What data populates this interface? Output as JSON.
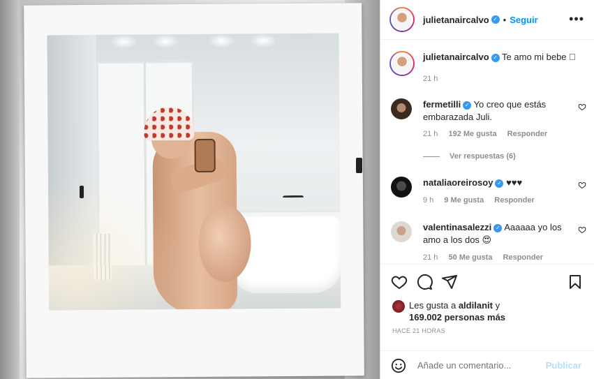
{
  "header": {
    "username": "julietanaircalvo",
    "follow_label": "Seguir",
    "more_icon": "more-options-icon"
  },
  "caption": {
    "username": "julietanaircalvo",
    "text": "Te amo mi bebe 🏼",
    "time": "21 h"
  },
  "comments": [
    {
      "username": "fermetilli",
      "text": "Yo creo que estás embarazada Juli.",
      "time": "21 h",
      "likes": "192 Me gusta",
      "reply": "Responder",
      "view_replies": "Ver respuestas (6)"
    },
    {
      "username": "nataliaoreirosoy",
      "text": "♥♥♥",
      "time": "9 h",
      "likes": "9 Me gusta",
      "reply": "Responder"
    },
    {
      "username": "valentinasalezzi",
      "text": "Aaaaaa yo los amo a los dos 😍",
      "time": "21 h",
      "likes": "50 Me gusta",
      "reply": "Responder"
    }
  ],
  "actions": {
    "like_icon": "heart-outline-icon",
    "comment_icon": "comment-bubble-icon",
    "share_icon": "share-paper-plane-icon",
    "save_icon": "bookmark-icon"
  },
  "likes": {
    "prefix": "Les gusta a ",
    "user": "aldilanit",
    "suffix": " y",
    "count": "169.002 personas más"
  },
  "post_time": "HACE 21 HORAS",
  "add_comment": {
    "placeholder": "Añade un comentario...",
    "publish_label": "Publicar"
  },
  "colors": {
    "accent": "#0095f6",
    "verified": "#3897f0",
    "muted": "#8e8e8e",
    "publish_disabled": "#b2dffc"
  }
}
